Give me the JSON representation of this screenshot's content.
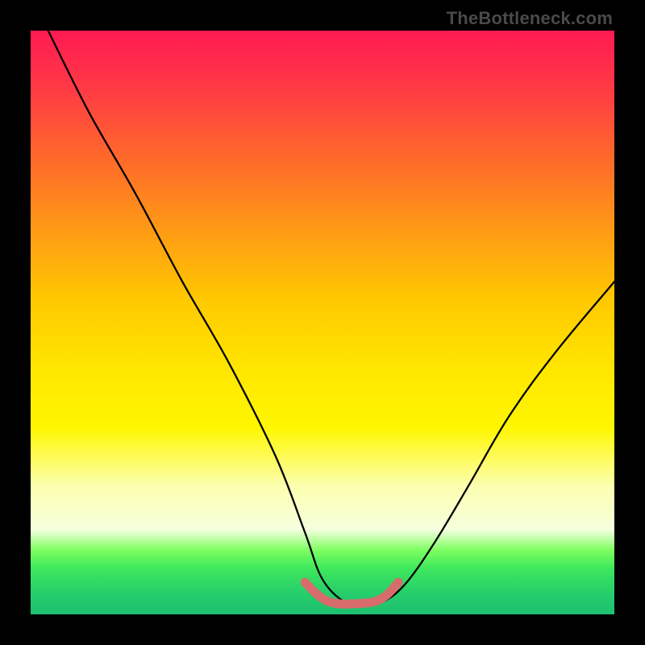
{
  "watermark": "TheBottleneck.com",
  "chart_data": {
    "type": "line",
    "title": "",
    "xlabel": "",
    "ylabel": "",
    "xlim": [
      0,
      100
    ],
    "ylim": [
      0,
      100
    ],
    "series": [
      {
        "name": "bottleneck-curve",
        "color": "#000000",
        "x": [
          3,
          10,
          18,
          26,
          34,
          42,
          47,
          50,
          54,
          57,
          60,
          64,
          69,
          75,
          82,
          90,
          100
        ],
        "values": [
          100,
          86,
          72,
          57,
          43,
          27,
          14,
          6,
          2,
          2,
          2,
          5,
          12,
          22,
          34,
          45,
          57
        ]
      },
      {
        "name": "optimal-zone",
        "color": "#d86b6b",
        "x": [
          47,
          49,
          51,
          53,
          55,
          57,
          59,
          61,
          63
        ],
        "values": [
          5.5,
          3.5,
          2.2,
          1.8,
          1.8,
          1.9,
          2.2,
          3.3,
          5.5
        ]
      }
    ],
    "annotations": []
  }
}
